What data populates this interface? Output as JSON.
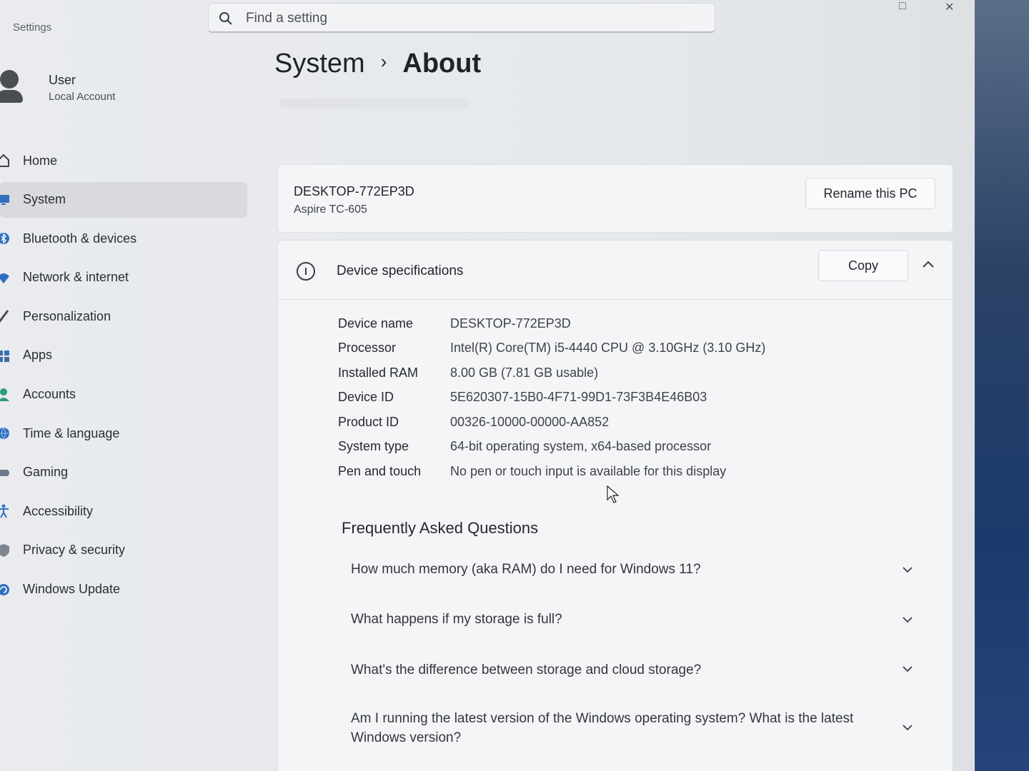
{
  "app": {
    "title": "Settings"
  },
  "search": {
    "placeholder": "Find a setting"
  },
  "user": {
    "name": "User",
    "account_type": "Local Account"
  },
  "nav": {
    "items": [
      {
        "label": "Home",
        "icon": "home-icon"
      },
      {
        "label": "System",
        "icon": "system-icon",
        "active": true
      },
      {
        "label": "Bluetooth & devices",
        "icon": "bluetooth-icon"
      },
      {
        "label": "Network & internet",
        "icon": "network-icon"
      },
      {
        "label": "Personalization",
        "icon": "brush-icon"
      },
      {
        "label": "Apps",
        "icon": "apps-icon"
      },
      {
        "label": "Accounts",
        "icon": "accounts-icon"
      },
      {
        "label": "Time & language",
        "icon": "globe-icon"
      },
      {
        "label": "Gaming",
        "icon": "gamepad-icon"
      },
      {
        "label": "Accessibility",
        "icon": "accessibility-icon"
      },
      {
        "label": "Privacy & security",
        "icon": "shield-icon"
      },
      {
        "label": "Windows Update",
        "icon": "update-icon"
      }
    ]
  },
  "breadcrumb": {
    "parent": "System",
    "separator": "›",
    "current": "About"
  },
  "pc": {
    "name": "DESKTOP-772EP3D",
    "model": "Aspire TC-605",
    "rename_label": "Rename this PC"
  },
  "specs": {
    "title": "Device specifications",
    "copy_label": "Copy",
    "rows": [
      {
        "key": "Device name",
        "value": "DESKTOP-772EP3D"
      },
      {
        "key": "Processor",
        "value": "Intel(R) Core(TM) i5-4440 CPU @ 3.10GHz (3.10 GHz)"
      },
      {
        "key": "Installed RAM",
        "value": "8.00 GB (7.81 GB usable)"
      },
      {
        "key": "Device ID",
        "value": "5E620307-15B0-4F71-99D1-73F3B4E46B03"
      },
      {
        "key": "Product ID",
        "value": "00326-10000-00000-AA852"
      },
      {
        "key": "System type",
        "value": "64-bit operating system, x64-based processor"
      },
      {
        "key": "Pen and touch",
        "value": "No pen or touch input is available for this display"
      }
    ]
  },
  "faq": {
    "title": "Frequently Asked Questions",
    "items": [
      {
        "q": "How much memory (aka RAM) do I need for Windows 11?"
      },
      {
        "q": "What happens if my storage is full?"
      },
      {
        "q": "What's the difference between storage and cloud storage?"
      },
      {
        "q": "Am I running the latest version of the Windows operating system? What is the latest Windows version?"
      }
    ]
  },
  "colors": {
    "accent": "#0067c0",
    "background": "#e9ebee",
    "card": "#f4f5f7"
  }
}
